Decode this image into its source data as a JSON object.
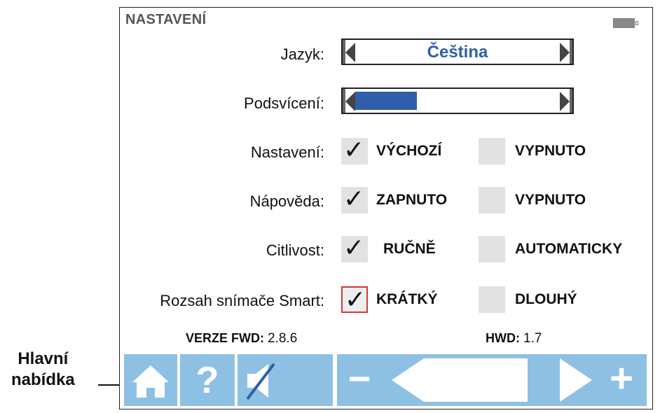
{
  "header": {
    "title": "NASTAVENÍ",
    "battery_icon": "battery-icon"
  },
  "language": {
    "label": "Jazyk:",
    "value": "Čeština"
  },
  "backlight": {
    "label": "Podsvícení:",
    "level_fraction": 0.3
  },
  "rows": [
    {
      "label": "Nastavení:",
      "option1": "VÝCHOZÍ",
      "option1_checked": true,
      "option2": "VYPNUTO",
      "option2_checked": false
    },
    {
      "label": "Nápověda:",
      "option1": "ZAPNUTO",
      "option1_checked": true,
      "option2": "VYPNUTO",
      "option2_checked": false
    },
    {
      "label": "Citlivost:",
      "option1": "RUČNĚ",
      "option1_checked": true,
      "option2": "AUTOMATICKY",
      "option2_checked": false
    },
    {
      "label": "Rozsah snímače Smart:",
      "option1": "KRÁTKÝ",
      "option1_checked": true,
      "option2": "DLOUHÝ",
      "option2_checked": false
    }
  ],
  "versions": {
    "fwd_label": "VERZE FWD:",
    "fwd_value": "2.8.6",
    "hwd_label": "HWD:",
    "hwd_value": "1.7"
  },
  "toolbar": {
    "home_icon": "home-icon",
    "help_label": "?",
    "mute_icon": "mute-icon",
    "minus_label": "−",
    "plus_label": "+"
  },
  "annotation": {
    "line1": "Hlavní",
    "line2": "nabídka"
  },
  "colors": {
    "accent_blue": "#2f5fa8",
    "toolbar_blue": "#8ec0e3",
    "focus_red": "#d23a3a"
  }
}
